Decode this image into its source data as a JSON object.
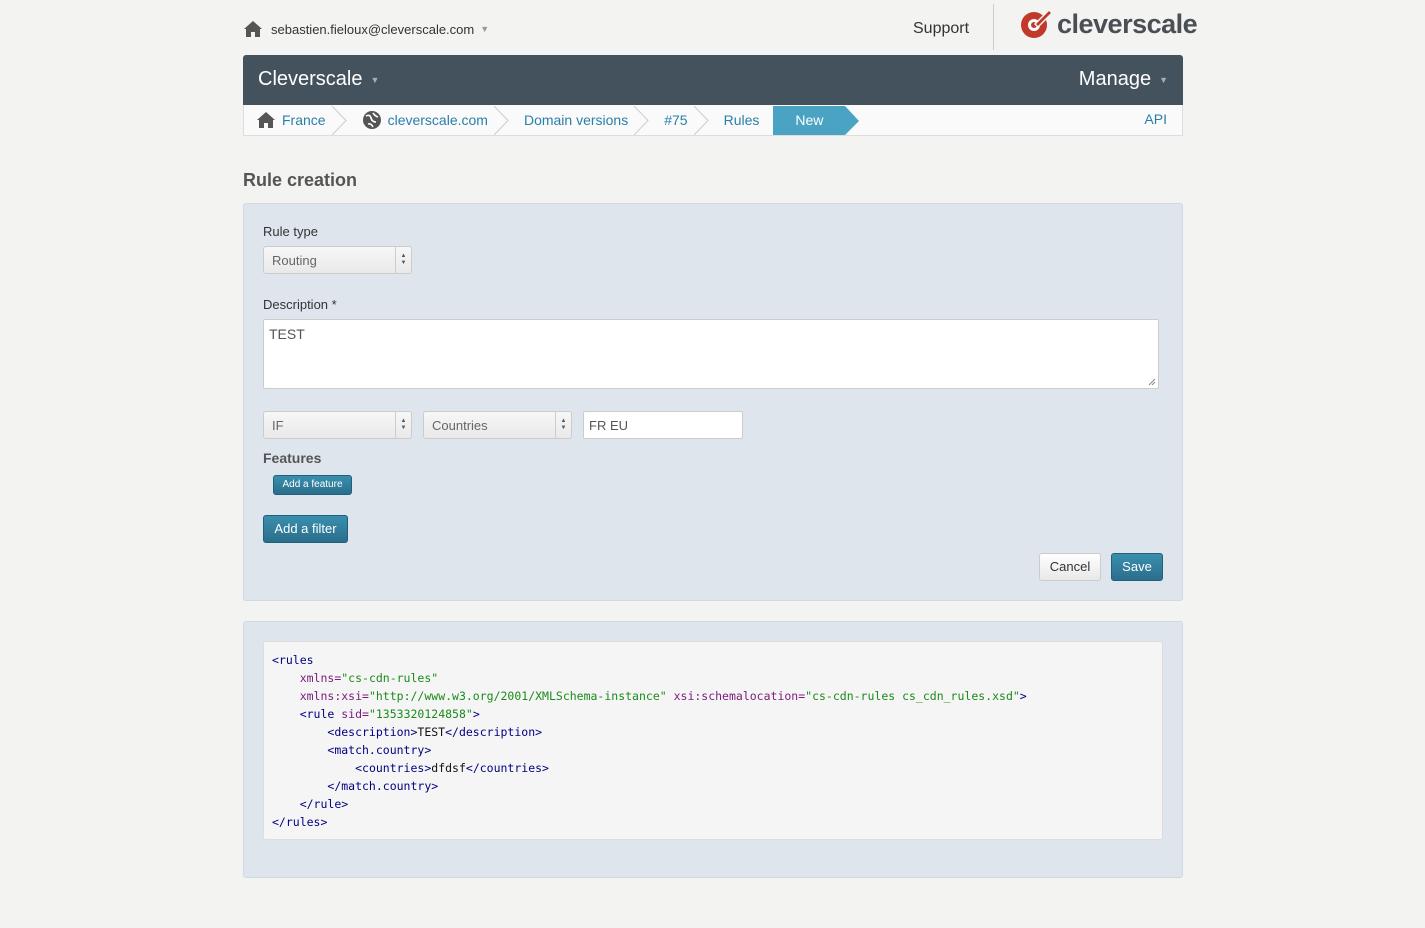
{
  "topbar": {
    "user_email": "sebastien.fieloux@cleverscale.com",
    "support_label": "Support",
    "logo_text": "cleverscale",
    "brand_color": "#c0392b"
  },
  "navbar": {
    "brand": "Cleverscale",
    "manage_label": "Manage",
    "bg_color": "#44525e"
  },
  "breadcrumb": {
    "items": [
      {
        "label": "France",
        "icon": "home-icon"
      },
      {
        "label": "cleverscale.com",
        "icon": "globe-icon"
      },
      {
        "label": "Domain versions"
      },
      {
        "label": "#75"
      },
      {
        "label": "Rules"
      },
      {
        "label": "New",
        "active": true
      }
    ],
    "api_label": "API"
  },
  "page": {
    "title": "Rule creation"
  },
  "form": {
    "rule_type_label": "Rule type",
    "rule_type_value": "Routing",
    "description_label": "Description *",
    "description_value": "TEST",
    "condition_value": "IF",
    "criteria_value": "Countries",
    "countries_value": "FR EU",
    "features_title": "Features",
    "add_feature_label": "Add a feature",
    "add_filter_label": "Add a filter",
    "cancel_label": "Cancel",
    "save_label": "Save"
  },
  "xml_preview": {
    "lines": [
      {
        "indent": 0,
        "parts": [
          [
            "tg",
            "<rules"
          ]
        ]
      },
      {
        "indent": 1,
        "parts": [
          [
            "at",
            "xmlns="
          ],
          [
            "vl",
            "\"cs-cdn-rules\""
          ]
        ]
      },
      {
        "indent": 1,
        "parts": [
          [
            "at",
            "xmlns:xsi="
          ],
          [
            "vl",
            "\"http://www.w3.org/2001/XMLSchema-instance\""
          ],
          [
            "at",
            " xsi:schemalocation="
          ],
          [
            "vl",
            "\"cs-cdn-rules cs_cdn_rules.xsd\""
          ],
          [
            "tg",
            ">"
          ]
        ]
      },
      {
        "indent": 1,
        "parts": [
          [
            "tg",
            "<rule "
          ],
          [
            "at",
            "sid="
          ],
          [
            "vl",
            "\"1353320124858\""
          ],
          [
            "tg",
            ">"
          ]
        ]
      },
      {
        "indent": 2,
        "parts": [
          [
            "tg",
            "<description>"
          ],
          [
            "tx",
            "TEST"
          ],
          [
            "tg",
            "</description>"
          ]
        ]
      },
      {
        "indent": 2,
        "parts": [
          [
            "tg",
            "<match.country>"
          ]
        ]
      },
      {
        "indent": 3,
        "parts": [
          [
            "tg",
            "<countries>"
          ],
          [
            "tx",
            "dfdsf"
          ],
          [
            "tg",
            "</countries>"
          ]
        ]
      },
      {
        "indent": 2,
        "parts": [
          [
            "tg",
            "</match.country>"
          ]
        ]
      },
      {
        "indent": 1,
        "parts": [
          [
            "tg",
            "</rule>"
          ]
        ]
      },
      {
        "indent": 0,
        "parts": [
          [
            "tg",
            "</rules>"
          ]
        ]
      }
    ]
  }
}
